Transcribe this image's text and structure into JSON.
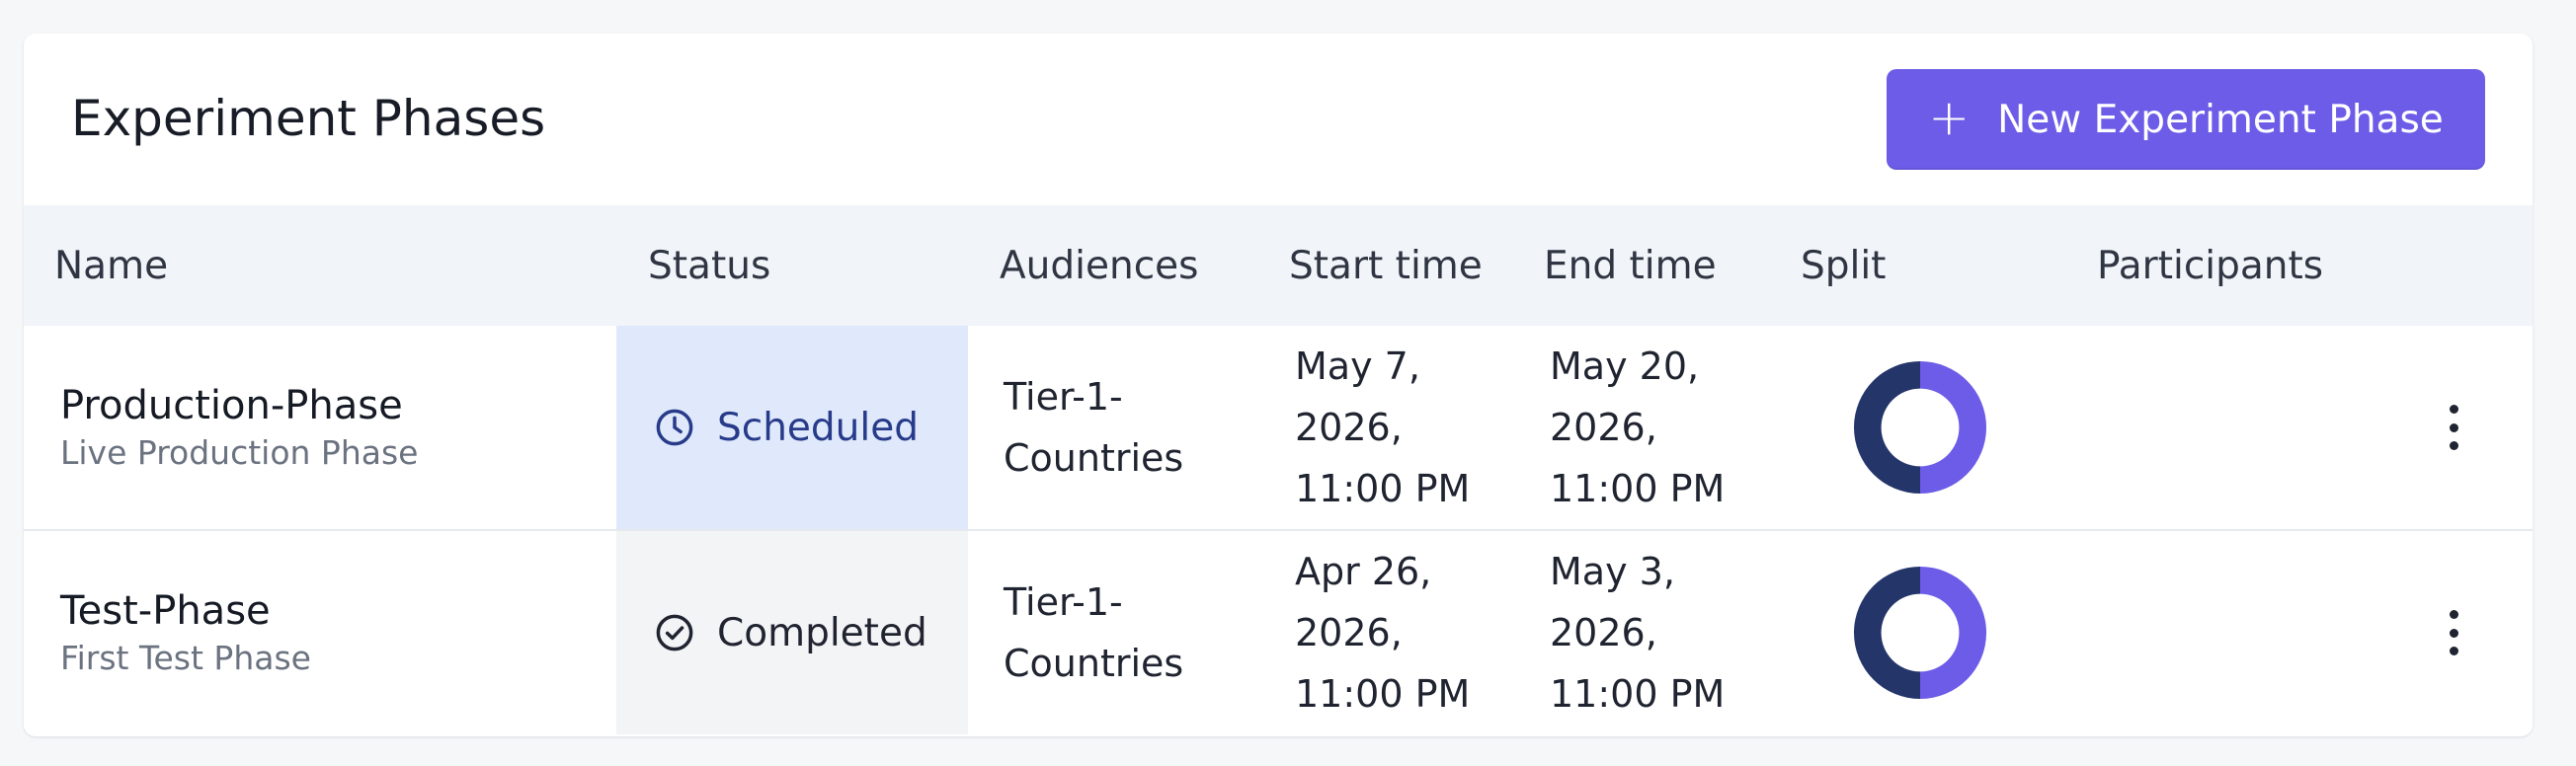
{
  "header": {
    "title": "Experiment Phases",
    "new_button_label": "New Experiment Phase",
    "new_button_icon": "plus-icon"
  },
  "table": {
    "columns": [
      "Name",
      "Status",
      "Audiences",
      "Start time",
      "End time",
      "Split",
      "Participants"
    ],
    "rows": [
      {
        "name": "Production-Phase",
        "description": "Live Production Phase",
        "status": "Scheduled",
        "status_icon": "clock-icon",
        "audiences": [
          "Tier-1-",
          "Countries"
        ],
        "start_time": [
          "May 7,",
          "2026,",
          "11:00 PM"
        ],
        "end_time": [
          "May 20,",
          "2026,",
          "11:00 PM"
        ],
        "split": [
          0.5,
          0.5
        ]
      },
      {
        "name": "Test-Phase",
        "description": "First Test Phase",
        "status": "Completed",
        "status_icon": "check-circle-icon",
        "audiences": [
          "Tier-1-",
          "Countries"
        ],
        "start_time": [
          "Apr 26,",
          "2026,",
          "11:00 PM"
        ],
        "end_time": [
          "May 3,",
          "2026,",
          "11:00 PM"
        ],
        "split": [
          0.5,
          0.5
        ]
      }
    ]
  },
  "colors": {
    "accent": "#6c5ce7",
    "split_primary": "#6c5ce7",
    "split_secondary": "#24356a",
    "scheduled_bg": "#dfe9fb",
    "scheduled_text": "#283b8a",
    "completed_bg": "#f3f4f6"
  }
}
